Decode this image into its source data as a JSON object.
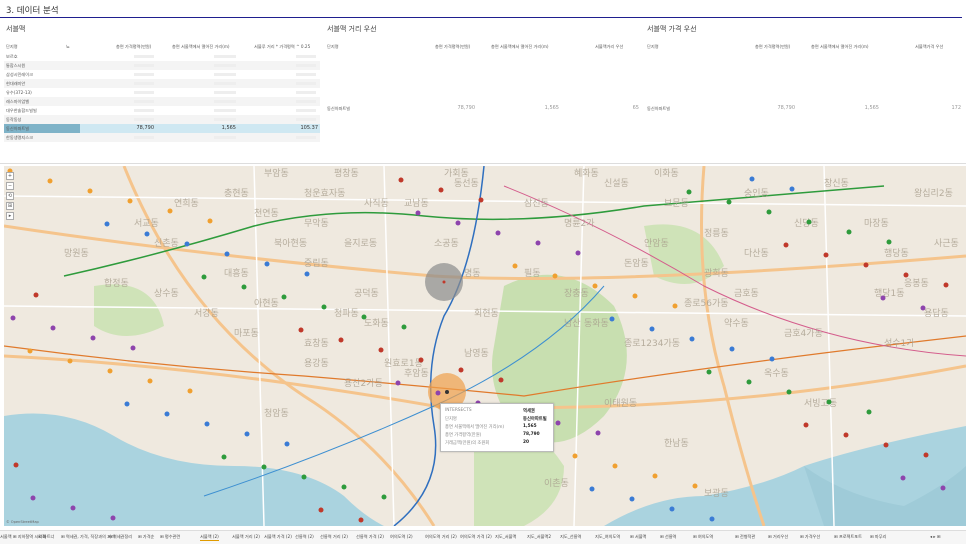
{
  "section_title": "3. 데이터 분석",
  "panels": [
    {
      "title": "서블맥"
    },
    {
      "title": "서블맥 거리 우선"
    },
    {
      "title": "서블맥 가격 우선"
    }
  ],
  "table1": {
    "headers": [
      "단지명",
      "뇨",
      "총면 가격평역(만원)",
      "총면 서울맥에서 떨어진 거리(m)",
      "서블루 거리 * 가격평역 ^ 0.25"
    ],
    "rows": [
      {
        "name": "보르호"
      },
      {
        "name": "통합스시원"
      },
      {
        "name": "삼성시민레이크"
      },
      {
        "name": "현대래미안"
      },
      {
        "name": "유수(372-13)"
      },
      {
        "name": "래스마이엄벨"
      },
      {
        "name": "대우한솔합드빌빌"
      },
      {
        "name": "동작동성"
      },
      {
        "name": "동신아파트빌",
        "v1": "78,790",
        "v2": "1,565",
        "v3": "105.37",
        "highlight": true
      },
      {
        "name": "한동생명지스크"
      }
    ]
  },
  "table2": {
    "headers": [
      "단지명",
      "총면 가격평역(만원)",
      "총면 서울맥에서 떨어진 거리(m)",
      "서블맥거리 우선"
    ],
    "row": {
      "name": "동신아파트빌",
      "v1": "78,790",
      "v2": "1,565",
      "v3": "65"
    }
  },
  "table3": {
    "headers": [
      "단지명",
      "총면 가격평역(만원)",
      "총면 서울맥에서 떨어진 거리(m)",
      "서블맥가격 우선"
    ],
    "row": {
      "name": "동신아파트빌",
      "v1": "78,790",
      "v2": "1,565",
      "v3": "172"
    }
  },
  "map": {
    "labels": [
      "동선동",
      "혜화동",
      "삼선동",
      "명륜2가",
      "이화동",
      "숭인동",
      "창신동",
      "신당동",
      "약수동",
      "금호4가동",
      "후암동",
      "용산2가동",
      "이태원동",
      "한남동",
      "보광동",
      "효창동",
      "청파동",
      "공덕동",
      "신촌동",
      "대흥동",
      "마포동",
      "용강동",
      "도화동",
      "아현동",
      "서강동",
      "남영동",
      "원효로1동",
      "서교동",
      "연희동",
      "이촌동",
      "옥수동",
      "성수1가",
      "금호동",
      "필동",
      "장충동",
      "회현동",
      "명동",
      "소공동",
      "교남동",
      "사직동",
      "평창동",
      "부암동",
      "가회동",
      "청운효자동",
      "무악동",
      "북아현동",
      "천연동",
      "충현동",
      "합정동",
      "망원동",
      "상수동",
      "청암동",
      "행당동",
      "응봉동",
      "마장동",
      "왕십리2동",
      "행당1동",
      "사근동",
      "용답동",
      "신설동",
      "보문동",
      "안암동",
      "돈암동",
      "정릉동",
      "종로1234가동",
      "종로56가동",
      "을지로동",
      "광희동",
      "다산동",
      "동화동",
      "중림동",
      "남산",
      "한강로동",
      "서빙고동"
    ],
    "attribution": "© OpenStreetMap",
    "controls": [
      "+",
      "−",
      "⟲",
      "⊞",
      "▸"
    ]
  },
  "tooltip": {
    "rows": [
      {
        "label": "INTERSECTS",
        "value": "역세권"
      },
      {
        "label": "단지명",
        "value": "동신아파트빌"
      },
      {
        "label": "총면 서울맥에서 떨어진 거리(m)",
        "value": "1,565"
      },
      {
        "label": "총면 가격평역(만원)",
        "value": "78,790"
      },
      {
        "label": "거래금액(만원)의 조원회",
        "value": "20"
      }
    ]
  },
  "tabs": [
    {
      "label": "서울맥 ⊞ 지하철역 시각화"
    },
    {
      "label": "⊞ 파트너"
    },
    {
      "label": "⊞ 역세권, 가격, 직장과의 거리"
    },
    {
      "label": "⊞ 역세권정리"
    },
    {
      "label": "⊞ 가격순"
    },
    {
      "label": "⊞ 평수관련"
    },
    {
      "label": "서블맥 (2)",
      "active": true
    },
    {
      "label": "서블맥 거리 (2)"
    },
    {
      "label": "서블맥 가격 (2)"
    },
    {
      "label": "선릉역 (2)"
    },
    {
      "label": "선릉역 거리 (2)"
    },
    {
      "label": "선릉역 가격 (2)"
    },
    {
      "label": "여의도역 (2)"
    },
    {
      "label": "여의도역 거리 (2)"
    },
    {
      "label": "여의도역 가격 (2)"
    },
    {
      "label": "지도_서블맥"
    },
    {
      "label": "지도_서블맥2"
    },
    {
      "label": "지도_선릉역"
    },
    {
      "label": "지도_여의도역"
    },
    {
      "label": "⊞ 서블맥"
    },
    {
      "label": "⊞ 선릉역"
    },
    {
      "label": "⊞ 여의도역"
    },
    {
      "label": "⊞ 전형적관"
    },
    {
      "label": "⊞ 거리우선"
    },
    {
      "label": "⊞ 가격우선"
    },
    {
      "label": "⊞ 프로젝트포트"
    },
    {
      "label": "⊞ 마무리"
    }
  ],
  "colors": {
    "accent_line": "#1f1f8f",
    "highlight_row": "#cfe8f2",
    "highlight_bar": "#7fb3c8",
    "river": "#aad3df",
    "park": "#c8dfb0",
    "subway_green": "#2e9b3c",
    "subway_blue": "#2f6fbf",
    "circle_gray": "#8c8c8c",
    "circle_orange": "#f0a04b"
  }
}
